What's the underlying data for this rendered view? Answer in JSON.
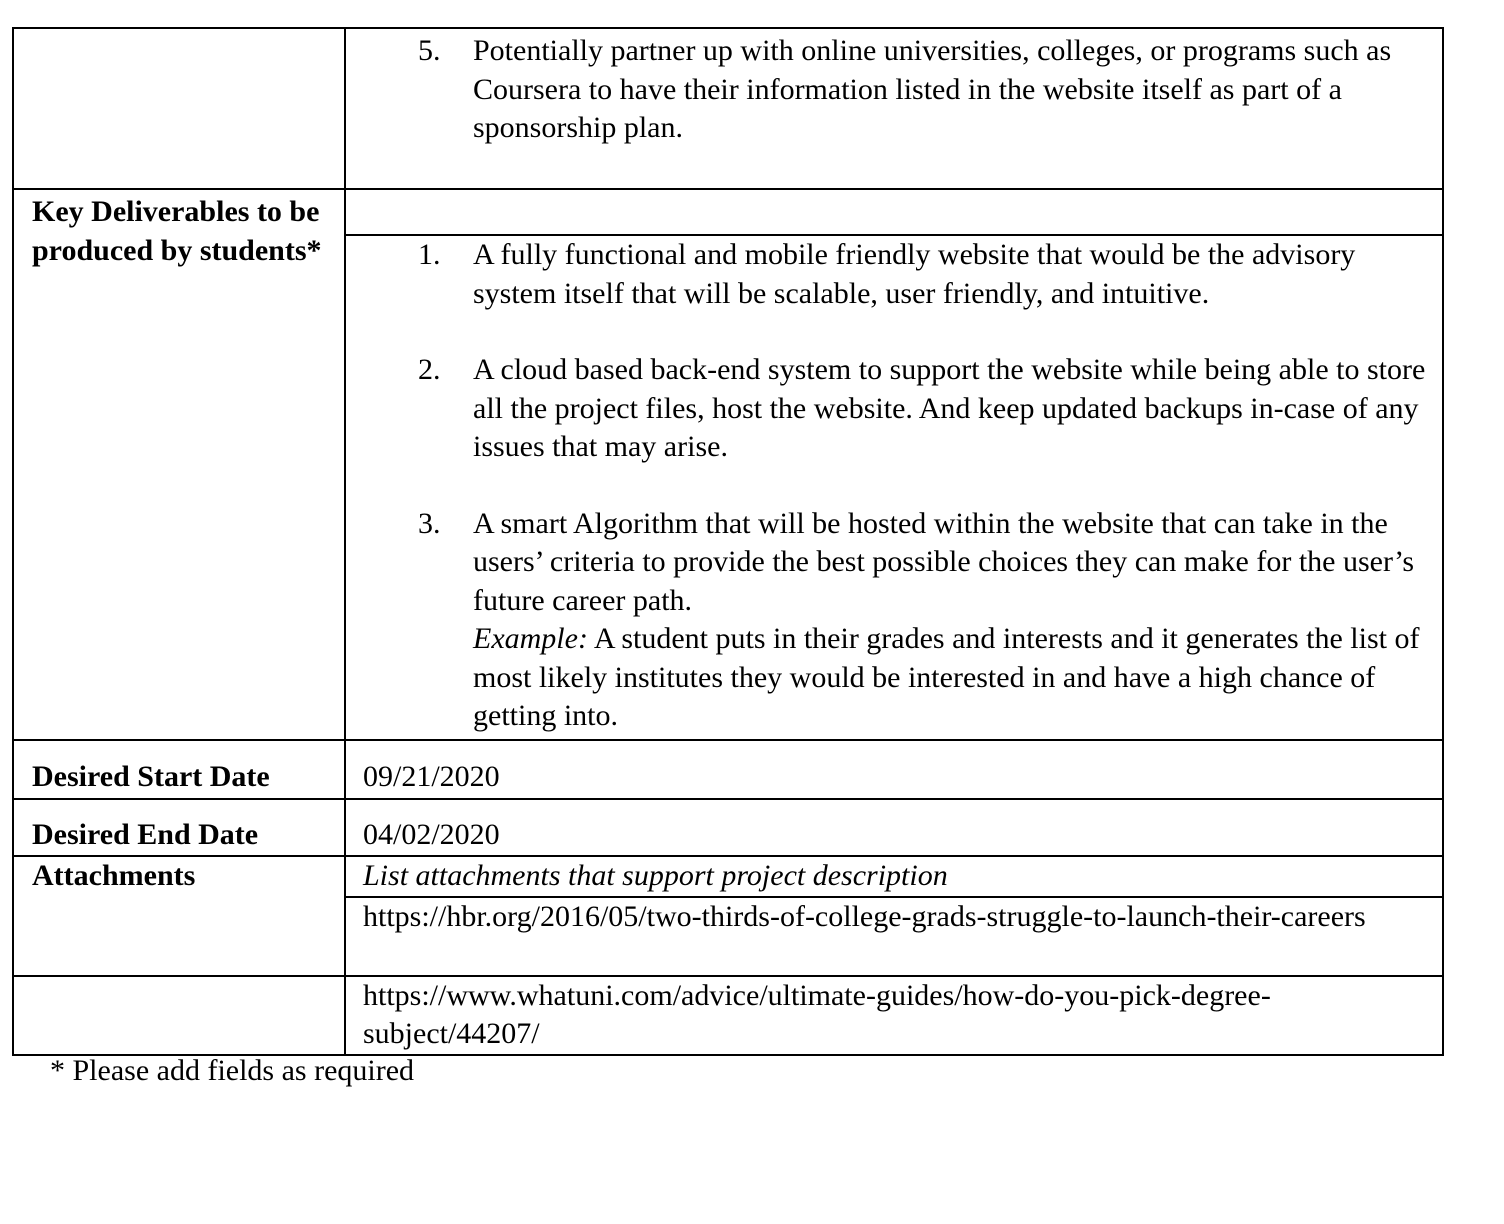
{
  "rows": {
    "continuation_item": {
      "number": "5.",
      "text": "Potentially partner up with online universities, colleges, or programs such as Coursera to have their information listed in the website itself as part of a sponsorship plan."
    },
    "deliverables": {
      "label": "Key Deliverables to be produced by students*",
      "items": [
        {
          "number": "1.",
          "text": "A fully functional and mobile friendly website that would be the advisory system itself that will be scalable, user friendly, and intuitive."
        },
        {
          "number": "2.",
          "text": "A cloud based back-end system to support the website while being able to store all the project files, host the website. And keep updated backups in-case of any issues that may arise."
        },
        {
          "number": "3.",
          "text": "A smart Algorithm that will be hosted within the website that can take in the users’ criteria to provide the best possible choices they can make for the user’s future career path.",
          "example_label": "Example:",
          "example_text": "A student puts in their grades and interests and it generates the list of most likely institutes they would be interested in and have a high chance of getting into."
        }
      ]
    },
    "start_date": {
      "label": "Desired Start Date",
      "value": "09/21/2020"
    },
    "end_date": {
      "label": "Desired End Date",
      "value": "04/02/2020"
    },
    "attachments": {
      "label": "Attachments",
      "hint": "List attachments that support project description",
      "links": [
        "https://hbr.org/2016/05/two-thirds-of-college-grads-struggle-to-launch-their-careers",
        "https://www.whatuni.com/advice/ultimate-guides/how-do-you-pick-degree-subject/44207/"
      ]
    }
  },
  "footnote": "* Please add fields as required"
}
